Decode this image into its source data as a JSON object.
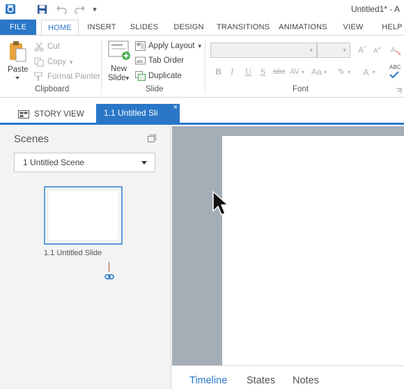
{
  "titlebar": {
    "title": "Untitled1* - A",
    "qat_more": "▾"
  },
  "ribbon_tabs": [
    {
      "label": "FILE"
    },
    {
      "label": "HOME"
    },
    {
      "label": "INSERT"
    },
    {
      "label": "SLIDES"
    },
    {
      "label": "DESIGN"
    },
    {
      "label": "TRANSITIONS"
    },
    {
      "label": "ANIMATIONS"
    },
    {
      "label": "VIEW"
    },
    {
      "label": "HELP"
    }
  ],
  "clipboard": {
    "paste_label": "Paste",
    "cut_label": "Cut",
    "copy_label": "Copy",
    "format_painter_label": "Format Painter",
    "group_label": "Clipboard"
  },
  "slide_group": {
    "new_slide_label_1": "New",
    "new_slide_label_2": "Slide",
    "apply_layout_label": "Apply Layout",
    "tab_order_label": "Tab Order",
    "duplicate_label": "Duplicate",
    "group_label": "Slide"
  },
  "font_group": {
    "group_label": "Font",
    "bold": "B",
    "italic": "I",
    "underline": "U",
    "shadow": "S",
    "strikethrough": "abc",
    "char_spacing": "AV",
    "change_case": "Aa",
    "font_color": "A",
    "spelling": "ABC"
  },
  "doc_tabs": {
    "story_view_label": "STORY VIEW",
    "active_tab_label": "1.1 Untitled Sli",
    "close_glyph": "×"
  },
  "scenes_panel": {
    "title": "Scenes",
    "selected_scene": "1 Untitled Scene",
    "slide_label": "1.1 Untitled Slide"
  },
  "bottom_tabs": [
    {
      "label": "Timeline",
      "active": true
    },
    {
      "label": "States",
      "active": false
    },
    {
      "label": "Notes",
      "active": false
    }
  ],
  "colors": {
    "accent": "#2b77c7",
    "stage_bg": "#a5adb7",
    "panel_bg": "#f3f3f3",
    "paste_icon": "#e8a33d",
    "new_slide_green": "#4caf50"
  }
}
